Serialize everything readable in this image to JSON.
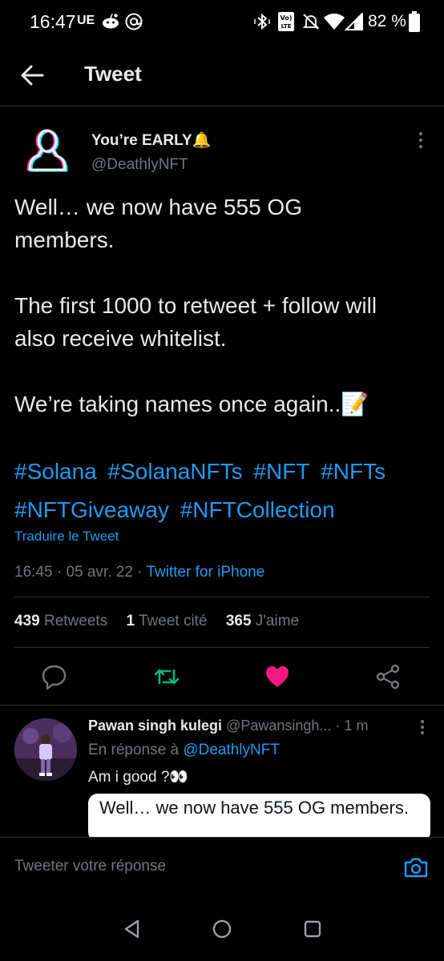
{
  "status_bar": {
    "time": "16:47",
    "carrier": "UE",
    "battery": "82 %"
  },
  "header": {
    "title": "Tweet"
  },
  "tweet": {
    "author_name": "You’re EARLY",
    "author_emoji": "🔔",
    "author_handle": "@DeathlyNFT",
    "paragraphs": [
      "Well… we now have 555 OG members.",
      "The first 1000 to retweet + follow will also receive whitelist.",
      "We’re taking names once again..📝"
    ],
    "hashtags": [
      "#Solana",
      "#SolanaNFTs",
      "#NFT",
      "#NFTs",
      "#NFTGiveaway",
      "#NFTCollection"
    ],
    "translate_label": "Traduire le Tweet",
    "time": "16:45",
    "date": "05 avr. 22",
    "source": "Twitter for iPhone"
  },
  "stats": {
    "retweets_count": "439",
    "retweets_label": "Retweets",
    "quotes_count": "1",
    "quotes_label": "Tweet cité",
    "likes_count": "365",
    "likes_label": "J'aime"
  },
  "actions": {
    "like_color": "#f91880",
    "retweet_color": "#00ba7c",
    "accent": "#1d9bf0"
  },
  "reply": {
    "name": "Pawan singh kulegi",
    "handle": "@Pawansingh...",
    "time": "1 m",
    "reply_to_prefix": "En réponse à",
    "reply_to_handle": "@DeathlyNFT",
    "text": "Am i good ?👀",
    "quote_text": "Well… we now have 555 OG members."
  },
  "composer": {
    "placeholder": "Tweeter votre réponse"
  }
}
